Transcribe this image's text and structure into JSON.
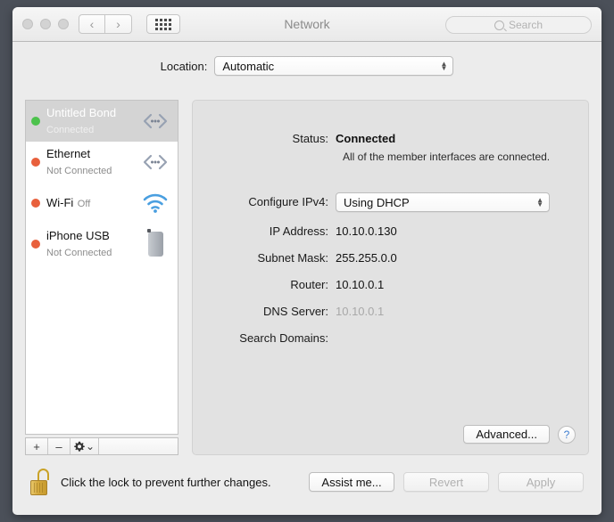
{
  "window": {
    "title": "Network",
    "traffic_lights": [
      "close",
      "minimize",
      "zoom"
    ],
    "nav_back": "‹",
    "nav_forward": "›",
    "grid_icon": "show-all-grid-icon"
  },
  "search": {
    "placeholder": "Search",
    "icon": "search-icon"
  },
  "location": {
    "label": "Location:",
    "value": "Automatic"
  },
  "sidebar": {
    "services": [
      {
        "name": "Untitled Bond",
        "status": "Connected",
        "dot": "green",
        "icon": "ethernet-bond-icon",
        "selected": true
      },
      {
        "name": "Ethernet",
        "status": "Not Connected",
        "dot": "red",
        "icon": "ethernet-icon",
        "selected": false
      },
      {
        "name": "Wi-Fi",
        "status": "Off",
        "dot": "red",
        "icon": "wifi-icon",
        "selected": false
      },
      {
        "name": "iPhone USB",
        "status": "Not Connected",
        "dot": "red",
        "icon": "iphone-icon",
        "selected": false
      }
    ],
    "toolbar": {
      "add": "+",
      "remove": "–",
      "actions_icon": "gear-icon",
      "actions_chevron": "⌄"
    }
  },
  "detail": {
    "status_label": "Status:",
    "status_value": "Connected",
    "status_detail": "All of the member interfaces are connected.",
    "configure_label": "Configure IPv4:",
    "configure_value": "Using DHCP",
    "ip_label": "IP Address:",
    "ip_value": "10.10.0.130",
    "subnet_label": "Subnet Mask:",
    "subnet_value": "255.255.0.0",
    "router_label": "Router:",
    "router_value": "10.10.0.1",
    "dns_label": "DNS Server:",
    "dns_value": "10.10.0.1",
    "search_domains_label": "Search Domains:",
    "search_domains_value": "",
    "advanced_label": "Advanced...",
    "help_label": "?"
  },
  "footer": {
    "lock_icon": "unlocked-padlock-icon",
    "lock_text": "Click the lock to prevent further changes.",
    "assist_label": "Assist me...",
    "revert_label": "Revert",
    "apply_label": "Apply"
  },
  "colors": {
    "accent_blue": "#3f7fd0",
    "status_green": "#4cc24c",
    "status_red": "#e8603c",
    "lock_gold": "#d4a83c"
  }
}
